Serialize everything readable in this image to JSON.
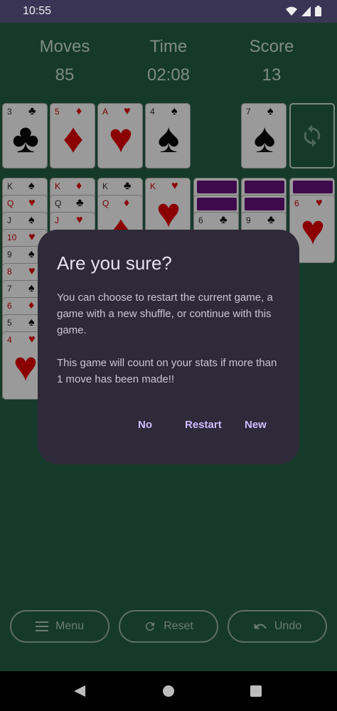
{
  "status_bar": {
    "time": "10:55",
    "icons": [
      "wifi-icon",
      "signal-icon",
      "battery-icon"
    ]
  },
  "stats": {
    "moves": {
      "label": "Moves",
      "value": "85"
    },
    "time": {
      "label": "Time",
      "value": "02:08"
    },
    "score": {
      "label": "Score",
      "value": "13"
    }
  },
  "foundation": [
    {
      "rank": "3",
      "suit": "clubs",
      "glyph": "♣",
      "color": "black"
    },
    {
      "rank": "5",
      "suit": "diamonds",
      "glyph": "♦",
      "color": "red"
    },
    {
      "rank": "A",
      "suit": "hearts",
      "glyph": "♥",
      "color": "red"
    },
    {
      "rank": "4",
      "suit": "spades",
      "glyph": "♠",
      "color": "black"
    }
  ],
  "waste": {
    "rank": "7",
    "suit": "spades",
    "glyph": "♠",
    "color": "black"
  },
  "stock": {
    "icon": "refresh-icon"
  },
  "tableau": [
    {
      "cards": [
        {
          "rank": "K",
          "glyph": "♠",
          "color": "black"
        },
        {
          "rank": "Q",
          "glyph": "♥",
          "color": "red"
        },
        {
          "rank": "J",
          "glyph": "♠",
          "color": "black"
        },
        {
          "rank": "10",
          "glyph": "♥",
          "color": "red"
        },
        {
          "rank": "9",
          "glyph": "♠",
          "color": "black"
        },
        {
          "rank": "8",
          "glyph": "♥",
          "color": "red"
        },
        {
          "rank": "7",
          "glyph": "♠",
          "color": "black"
        },
        {
          "rank": "6",
          "glyph": "♦",
          "color": "red"
        },
        {
          "rank": "5",
          "glyph": "♠",
          "color": "black"
        },
        {
          "rank": "4",
          "glyph": "♥",
          "color": "red"
        }
      ]
    },
    {
      "cards": [
        {
          "rank": "K",
          "glyph": "♦",
          "color": "red"
        },
        {
          "rank": "Q",
          "glyph": "♣",
          "color": "black"
        },
        {
          "rank": "J",
          "glyph": "♥",
          "color": "red"
        }
      ]
    },
    {
      "cards": [
        {
          "rank": "K",
          "glyph": "♣",
          "color": "black"
        },
        {
          "rank": "Q",
          "glyph": "♦",
          "color": "red"
        }
      ]
    },
    {
      "cards": [
        {
          "rank": "K",
          "glyph": "♥",
          "color": "red"
        }
      ]
    },
    {
      "hidden": 2,
      "cards": [
        {
          "rank": "6",
          "glyph": "♣",
          "color": "black"
        }
      ]
    },
    {
      "hidden": 2,
      "cards": [
        {
          "rank": "9",
          "glyph": "♣",
          "color": "black"
        }
      ]
    },
    {
      "hidden": 1,
      "cards": [
        {
          "rank": "6",
          "glyph": "♥",
          "color": "red"
        }
      ]
    }
  ],
  "buttons": {
    "menu": {
      "label": "Menu",
      "icon": "menu-icon"
    },
    "reset": {
      "label": "Reset",
      "icon": "refresh-icon"
    },
    "undo": {
      "label": "Undo",
      "icon": "undo-icon"
    }
  },
  "dialog": {
    "title": "Are you sure?",
    "message": "You can choose to restart the current game, a game with a new shuffle, or continue with this game.\n\nThis game will count on your stats if more than 1 move has been made!!",
    "actions": {
      "no": "No",
      "restart": "Restart",
      "new": "New"
    }
  },
  "colors": {
    "table": "#163a2a",
    "dialog": "#2e2a3a",
    "accent": "#cfbcff",
    "card_back": "#3f0a4d"
  }
}
